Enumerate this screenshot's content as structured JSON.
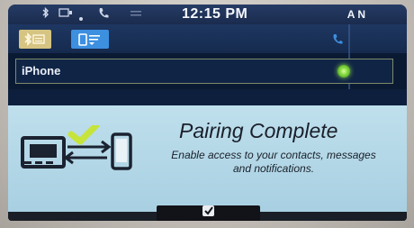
{
  "status_bar": {
    "time": "12:15 PM",
    "signal_label": "A N",
    "icons": [
      "bluetooth-icon",
      "messages-icon",
      "phone-status-icon",
      "call-icon",
      "menu-icon"
    ]
  },
  "toolbar": {
    "tabs": [
      {
        "icon": "bluetooth-device-icon",
        "active": false
      },
      {
        "icon": "phone-keypad-icon",
        "active": true
      }
    ],
    "call_icon": "handset-icon"
  },
  "devices": [
    {
      "name": "iPhone",
      "connected": true,
      "status_color": "#7fd63c"
    }
  ],
  "popup": {
    "title": "Pairing Complete",
    "message_line1": "Enable access to your contacts, messages",
    "message_line2": "and notifications.",
    "confirm_icon": "checkmark-icon"
  },
  "colors": {
    "background": "#0b1a33",
    "accent_blue": "#3d8fe0",
    "popup_bg": "#bfdfec",
    "check_green": "#c6e43a"
  }
}
